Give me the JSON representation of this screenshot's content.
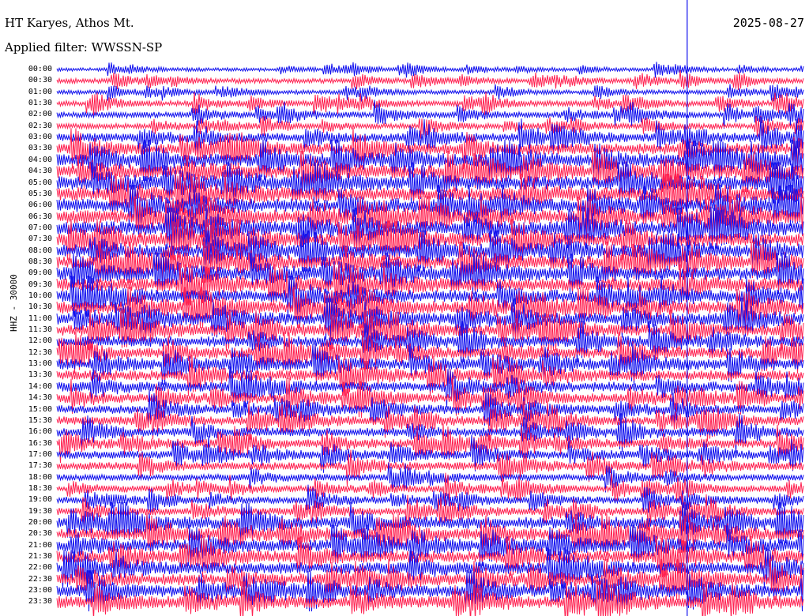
{
  "header": {
    "station": "HT Karyes, Athos Mt.",
    "filter": "Applied filter: WWSSN-SP",
    "date": "2025-08-27"
  },
  "channel_label": "HHZ - 30000",
  "colors": {
    "trace_a": "#1010ee",
    "trace_b": "#ff2050",
    "marker": "#1010ee",
    "marker_red": "#ff2050",
    "background": "#ffffff"
  },
  "chart_data": {
    "type": "line",
    "title": "",
    "xlabel": "",
    "ylabel": "HHZ - 30000",
    "row_labels": [
      "00:00",
      "00:30",
      "01:00",
      "01:30",
      "02:00",
      "02:30",
      "03:00",
      "03:30",
      "04:00",
      "04:30",
      "05:00",
      "05:30",
      "06:00",
      "06:30",
      "07:00",
      "07:30",
      "08:00",
      "08:30",
      "09:00",
      "09:30",
      "10:00",
      "10:30",
      "11:00",
      "11:30",
      "12:00",
      "12:30",
      "13:00",
      "13:30",
      "14:00",
      "14:30",
      "15:00",
      "15:30",
      "16:00",
      "16:30",
      "17:00",
      "17:30",
      "18:00",
      "18:30",
      "19:00",
      "19:30",
      "20:00",
      "20:30",
      "21:00",
      "21:30",
      "22:00",
      "22:30",
      "23:00",
      "23:30"
    ],
    "row_colors": [
      "trace_a",
      "trace_b"
    ],
    "relative_amplitude": [
      0.15,
      0.25,
      0.2,
      0.3,
      0.35,
      0.3,
      0.55,
      0.75,
      0.85,
      0.9,
      0.95,
      0.95,
      0.95,
      0.95,
      0.95,
      0.9,
      0.9,
      0.9,
      0.9,
      0.9,
      0.85,
      0.85,
      0.8,
      0.75,
      0.7,
      0.7,
      0.7,
      0.7,
      0.65,
      0.6,
      0.55,
      0.55,
      0.55,
      0.55,
      0.5,
      0.5,
      0.4,
      0.4,
      0.4,
      0.45,
      0.8,
      0.8,
      0.8,
      0.8,
      0.8,
      0.8,
      0.8,
      0.8
    ],
    "vertical_markers": [
      {
        "minute": 25.3,
        "color": "marker"
      },
      {
        "minute": 52.1,
        "color": "marker_red"
      }
    ]
  }
}
